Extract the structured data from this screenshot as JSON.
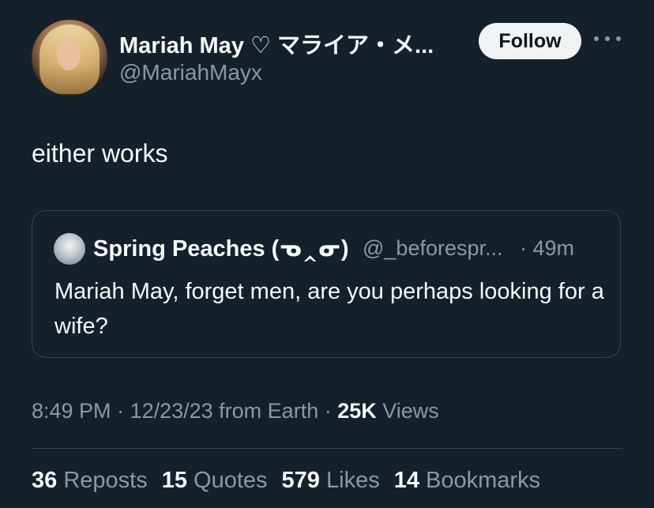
{
  "author": {
    "display_name": "Mariah May ♡ マライア・メ...",
    "handle": "@MariahMayx",
    "follow_label": "Follow"
  },
  "tweet": {
    "text": "either works"
  },
  "quote": {
    "name": "Spring Peaches (ᓀ‸ᓂ)",
    "handle": "@_beforespr...",
    "time": "· 49m",
    "text": "Mariah May, forget men, are you perhaps looking for a wife?"
  },
  "meta": {
    "time": "8:49 PM",
    "sep1": " · ",
    "date": "12/23/23",
    "source": " from Earth",
    "sep2": " · ",
    "views_count": "25K",
    "views_label": " Views"
  },
  "stats": {
    "reposts_count": "36",
    "reposts_label": " Reposts",
    "quotes_count": "15",
    "quotes_label": " Quotes",
    "likes_count": "579",
    "likes_label": " Likes",
    "bookmarks_count": "14",
    "bookmarks_label": " Bookmarks"
  },
  "icons": {
    "more": "more-icon"
  },
  "colors": {
    "background": "#15202b",
    "text": "#f7f9f9",
    "muted": "#8b98a5",
    "border": "#38444d",
    "follow_bg": "#eff3f4"
  }
}
